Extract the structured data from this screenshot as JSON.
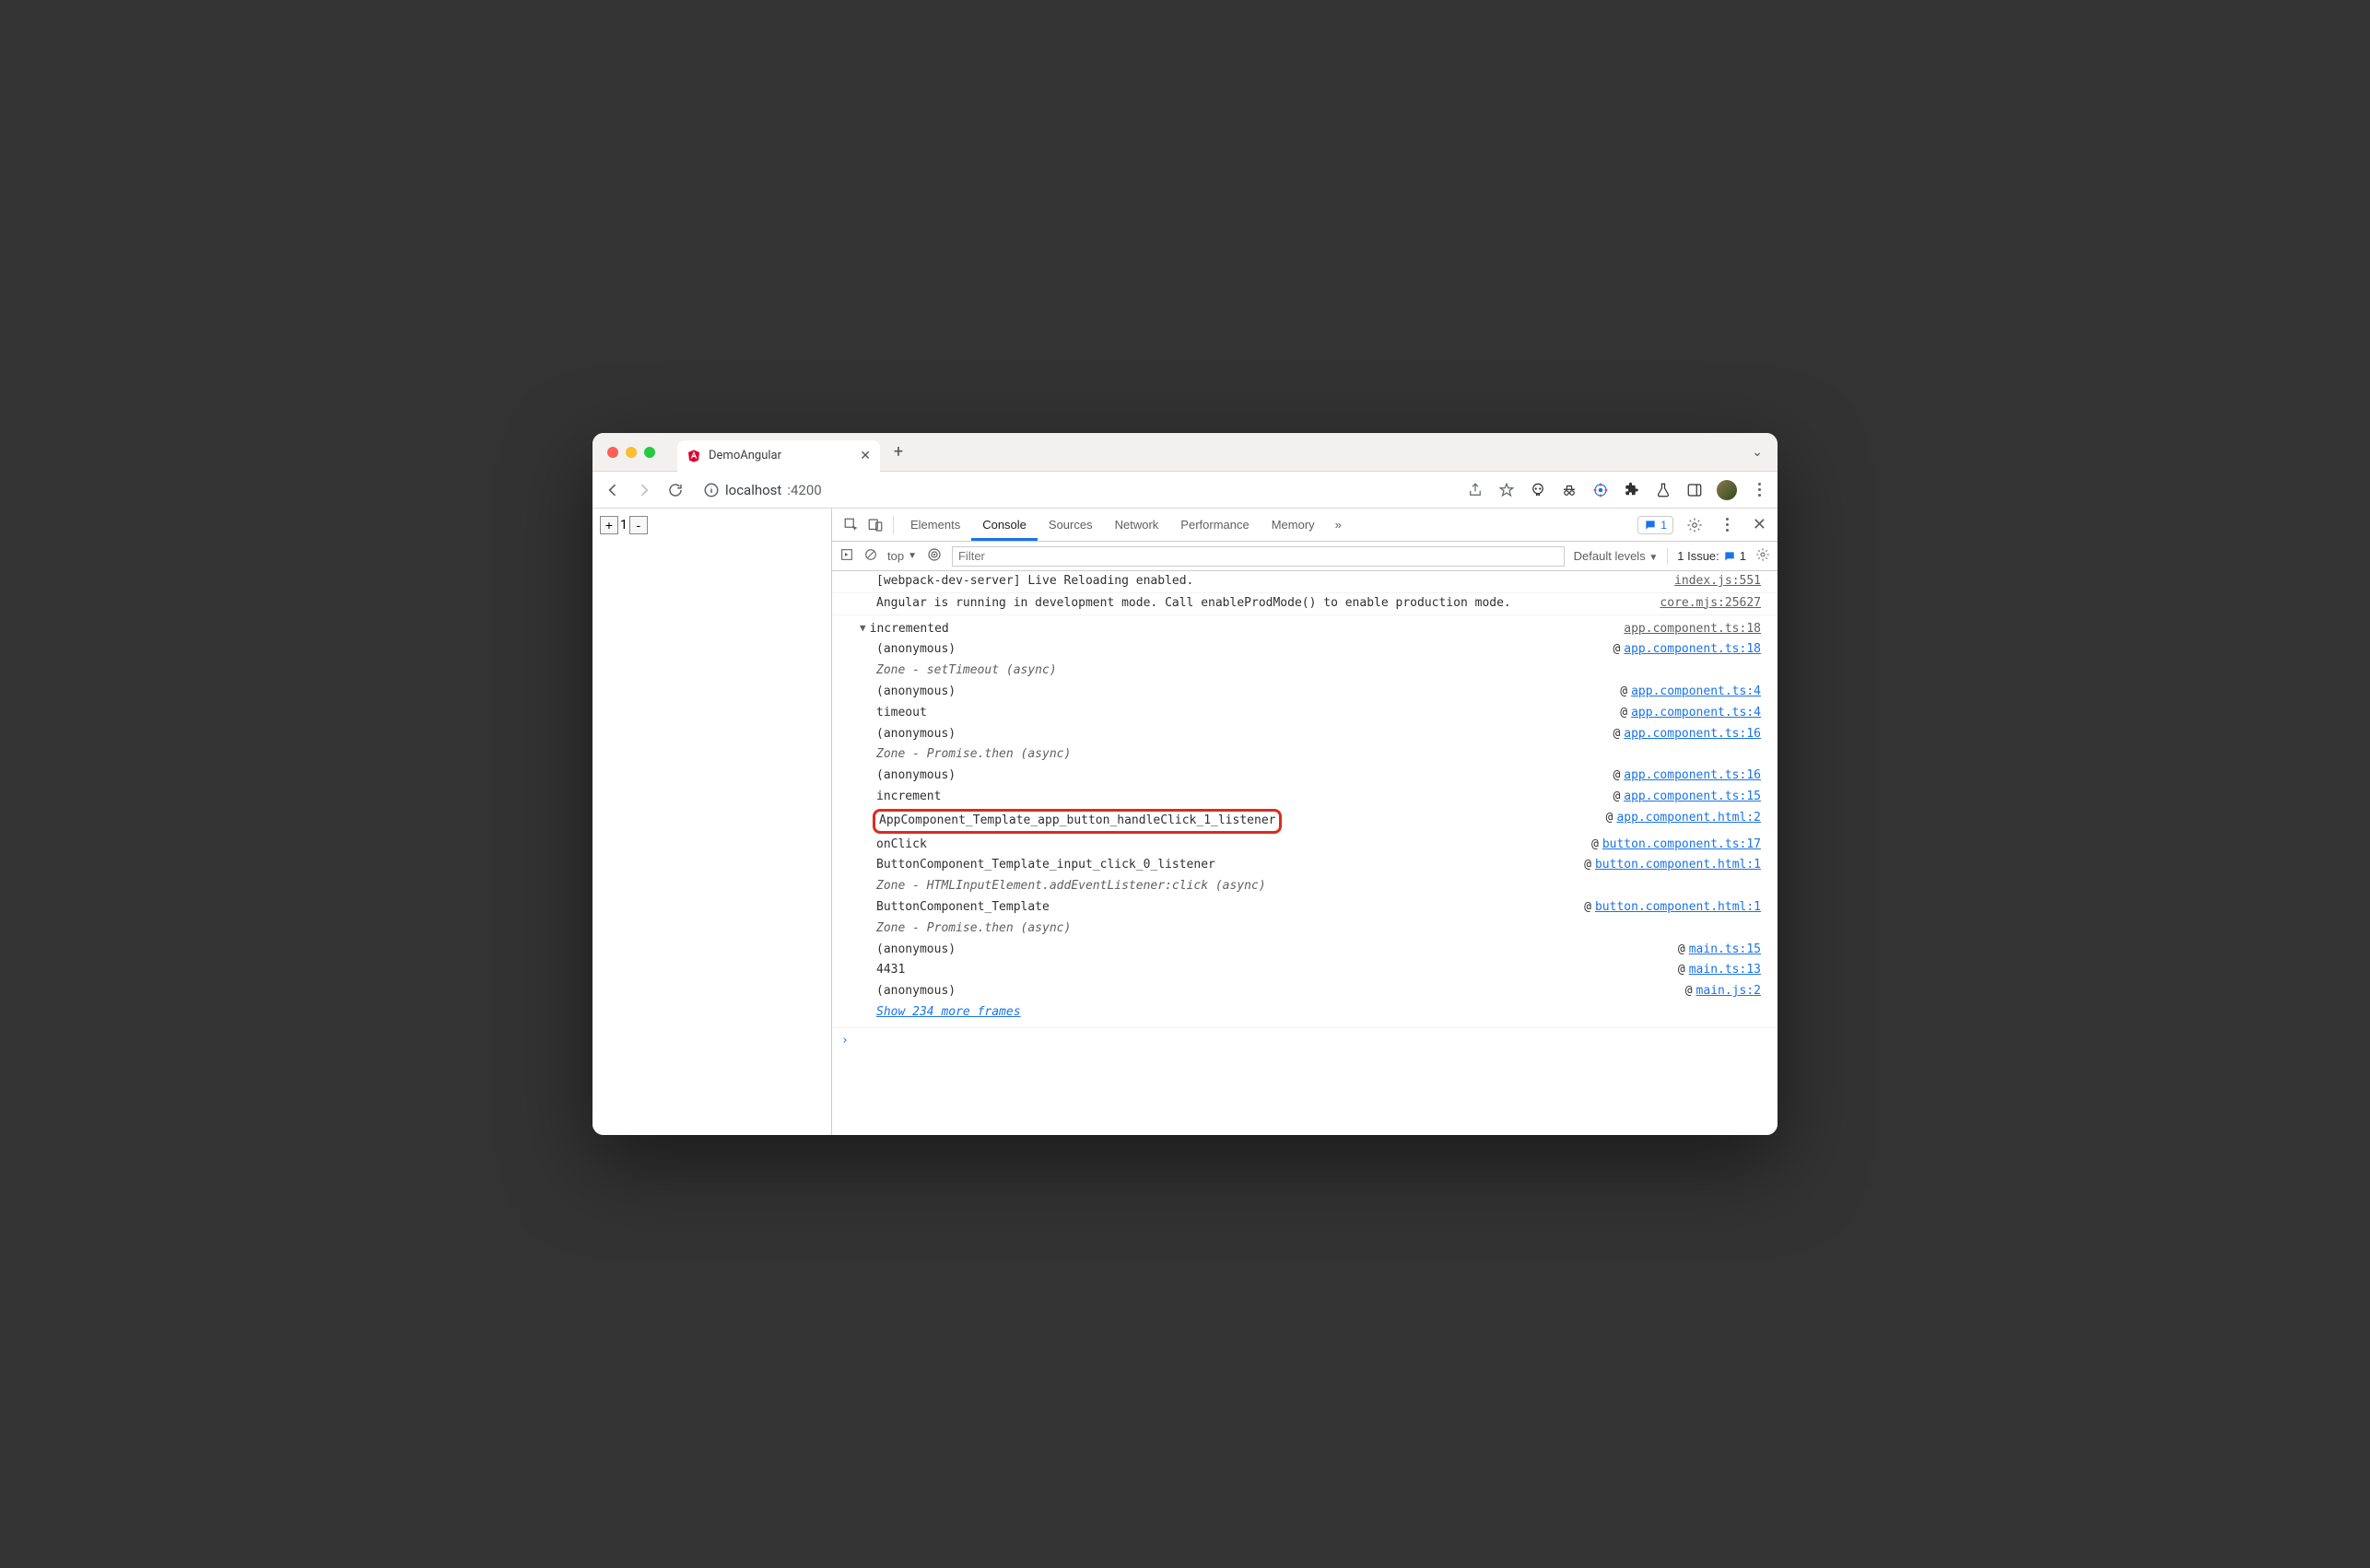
{
  "browser": {
    "tab_title": "DemoAngular",
    "url_host": "localhost",
    "url_port": ":4200",
    "new_tab_glyph": "+",
    "close_glyph": "✕",
    "chevron_glyph": "⌄"
  },
  "page": {
    "plus": "+",
    "value": "1",
    "minus": "-"
  },
  "devtools": {
    "tabs": [
      "Elements",
      "Console",
      "Sources",
      "Network",
      "Performance",
      "Memory"
    ],
    "more": "»",
    "issues_count": "1",
    "toolbar": {
      "context": "top",
      "filter_placeholder": "Filter",
      "levels": "Default levels",
      "issue_label": "1 Issue:",
      "issue_count": "1"
    }
  },
  "console": {
    "line1_msg": "[webpack-dev-server] Live Reloading enabled.",
    "line1_src": "index.js:551",
    "line2_msg": "Angular is running in development mode. Call enableProdMode() to enable production mode.",
    "line2_src": "core.mjs:25627",
    "trace_label": "incremented",
    "trace_src": "app.component.ts:18",
    "frames": [
      {
        "fn": "(anonymous)",
        "link": "app.component.ts:18"
      },
      {
        "fn": "Zone - setTimeout (async)",
        "italic": true
      },
      {
        "fn": "(anonymous)",
        "link": "app.component.ts:4"
      },
      {
        "fn": "timeout",
        "link": "app.component.ts:4"
      },
      {
        "fn": "(anonymous)",
        "link": "app.component.ts:16"
      },
      {
        "fn": "Zone - Promise.then (async)",
        "italic": true
      },
      {
        "fn": "(anonymous)",
        "link": "app.component.ts:16"
      },
      {
        "fn": "increment",
        "link": "app.component.ts:15"
      },
      {
        "fn": "AppComponent_Template_app_button_handleClick_1_listener",
        "link": "app.component.html:2",
        "hl": true
      },
      {
        "fn": "onClick",
        "link": "button.component.ts:17"
      },
      {
        "fn": "ButtonComponent_Template_input_click_0_listener",
        "link": "button.component.html:1"
      },
      {
        "fn": "Zone - HTMLInputElement.addEventListener:click (async)",
        "italic": true
      },
      {
        "fn": "ButtonComponent_Template",
        "link": "button.component.html:1"
      },
      {
        "fn": "Zone - Promise.then (async)",
        "italic": true
      },
      {
        "fn": "(anonymous)",
        "link": "main.ts:15"
      },
      {
        "fn": "4431",
        "link": "main.ts:13"
      },
      {
        "fn": "(anonymous)",
        "link": "main.js:2"
      }
    ],
    "show_more": "Show 234 more frames",
    "prompt": "›"
  }
}
